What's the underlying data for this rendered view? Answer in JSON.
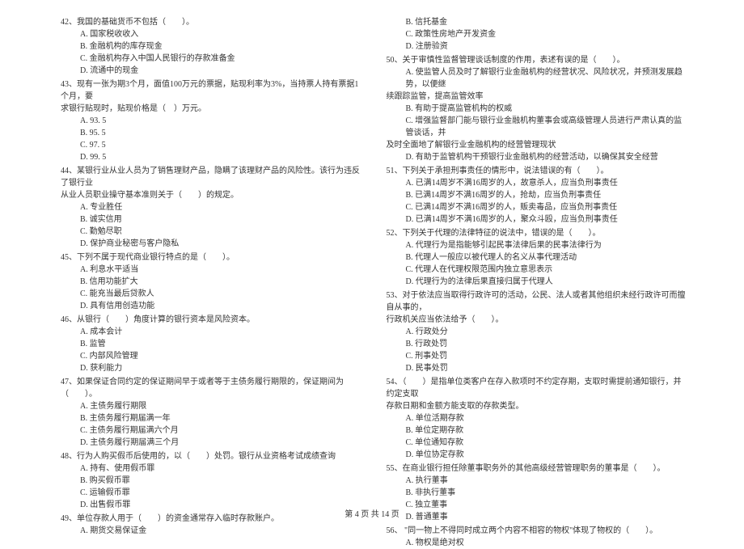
{
  "leftColumn": {
    "q42": {
      "stem": "42、我国的基础货币不包括（　　）。",
      "options": [
        "A. 国家税收收入",
        "B. 金融机构的库存现金",
        "C. 金融机构存入中国人民银行的存款准备金",
        "D. 流通中的现金"
      ]
    },
    "q43": {
      "stem1": "43、现有一张为期3个月，面值100万元的票据，贴现利率为3%，当持票人持有票据1个月，要",
      "stem2": "求银行贴现时，贴现价格是（　）万元。",
      "options": [
        "A. 93. 5",
        "B. 95. 5",
        "C. 97. 5",
        "D. 99. 5"
      ]
    },
    "q44": {
      "stem1": "44、某银行业从业人员为了销售理财产品，隐瞒了该理财产品的风险性。该行为违反了银行业",
      "stem2": "从业人员职业操守基本准则关于（　　）的规定。",
      "options": [
        "A. 专业胜任",
        "B. 诚实信用",
        "C. 勤勉尽职",
        "D. 保护商业秘密与客户隐私"
      ]
    },
    "q45": {
      "stem": "45、下列不属于现代商业银行特点的是（　　）。",
      "options": [
        "A. 利息水平适当",
        "B. 信用功能扩大",
        "C. 能充当最后贷款人",
        "D. 具有信用创造功能"
      ]
    },
    "q46": {
      "stem": "46、从银行（　　）角度计算的银行资本是风险资本。",
      "options": [
        "A. 成本会计",
        "B. 监管",
        "C. 内部风险管理",
        "D. 获利能力"
      ]
    },
    "q47": {
      "stem": "47、如果保证合同约定的保证期间早于或者等于主债务履行期限的，保证期间为（　　）。",
      "options": [
        "A. 主债务履行期限",
        "B. 主债务履行期届满一年",
        "C. 主债务履行期届满六个月",
        "D. 主债务履行期届满三个月"
      ]
    },
    "q48": {
      "stem": "48、行为人购买假币后使用的，以（　　）处罚。银行从业资格考试成绩查询",
      "options": [
        "A. 持有、使用假币罪",
        "B. 购买假币罪",
        "C. 运输假币罪",
        "D. 出售假币罪"
      ]
    },
    "q49": {
      "stem": "49、单位存款人用于（　　）的资金通常存入临时存款账户。",
      "options": [
        "A. 期货交易保证金"
      ]
    }
  },
  "rightColumn": {
    "q49cont": {
      "options": [
        "B. 信托基金",
        "C. 政策性房地产开发资金",
        "D. 注册验资"
      ]
    },
    "q50": {
      "stem": "50、关于审慎性监督管理谈话制度的作用，表述有误的是（　　）。",
      "optA1": "A. 使监管人员及时了解银行业金融机构的经营状况、风险状况，并预测发展趋势，以便继",
      "optA2": "续跟踪监管，提高监管效率",
      "options": [
        "B. 有助于提高监管机构的权威",
        "C. 增强监督部门能与银行业金融机构董事会或高级管理人员进行严肃认真的监管谈话，并",
        "及时全面地了解银行业金融机构的经营管理现状",
        "D. 有助于监管机构干预银行业金融机构的经营活动，以确保其安全经营"
      ]
    },
    "q51": {
      "stem": "51、下列关于承担刑事责任的情形中，说法错误的有（　　）。",
      "options": [
        "A. 已满14周岁不满16周岁的人，故意杀人，应当负刑事责任",
        "B. 已满14周岁不满16周岁的人，抢劫，应当负刑事责任",
        "C. 已满14周岁不满16周岁的人，贩卖毒品，应当负刑事责任",
        "D. 已满14周岁不满16周岁的人，聚众斗殴，应当负刑事责任"
      ]
    },
    "q52": {
      "stem": "52、下列关于代理的法律特征的说法中，错误的是（　　）。",
      "options": [
        "A. 代理行为是指能够引起民事法律后果的民事法律行为",
        "B. 代理人一般应以被代理人的名义从事代理活动",
        "C. 代理人在代理权限范围内独立意思表示",
        "D. 代理行为的法律后果直接归属于代理人"
      ]
    },
    "q53": {
      "stem1": "53、对于依法应当取得行政许可的活动，公民、法人或者其他组织未经行政许可而擅自从事的，",
      "stem2": "行政机关应当依法给予（　　）。",
      "options": [
        "A. 行政处分",
        "B. 行政处罚",
        "C. 刑事处罚",
        "D. 民事处罚"
      ]
    },
    "q54": {
      "stem1": "54、（　　）是指单位类客户在存入款项时不约定存期，支取时需提前通知银行，并约定支取",
      "stem2": "存款日期和金额方能支取的存款类型。",
      "options": [
        "A. 单位活期存款",
        "B. 单位定期存款",
        "C. 单位通知存款",
        "D. 单位协定存款"
      ]
    },
    "q55": {
      "stem": "55、在商业银行担任除董事职务外的其他高级经营管理职务的董事是（　　）。",
      "options": [
        "A. 执行董事",
        "B. 非执行董事",
        "C. 独立董事",
        "D. 普通董事"
      ]
    },
    "q56": {
      "stem": "56、 \"同一物上不得同时成立两个内容不相容的物权\"体现了物权的（　　）。",
      "options": [
        "A. 物权是绝对权"
      ]
    }
  },
  "footer": "第 4 页 共 14 页"
}
